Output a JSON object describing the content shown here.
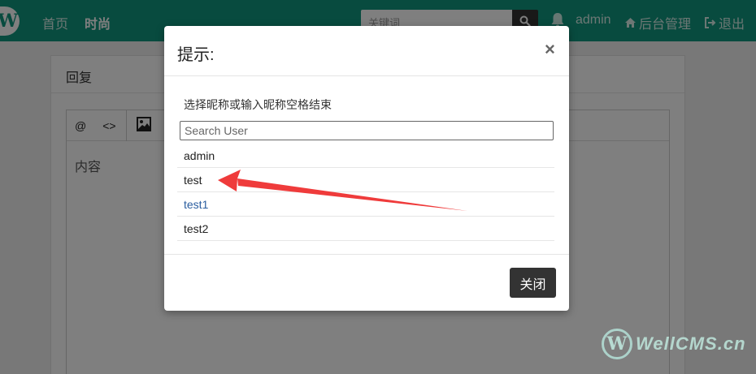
{
  "navbar": {
    "logo_letter": "W",
    "home": "首页",
    "fashion": "时尚",
    "search_placeholder": "关键词",
    "user": "admin",
    "backend": "后台管理",
    "logout": "退出",
    "bg_color": "#10967e"
  },
  "panel": {
    "title": "回复",
    "toolbar": [
      "@",
      "<>"
    ],
    "placeholder": "内容"
  },
  "modal": {
    "title": "提示:",
    "close_symbol": "×",
    "hint": "选择昵称或输入昵称空格结束",
    "search_placeholder": "Search User",
    "users": [
      "admin",
      "test",
      "test1",
      "test2"
    ],
    "close_label": "关闭"
  },
  "watermark": {
    "letter": "W",
    "text": "WellCMS.cn"
  },
  "annotation": {
    "arrow_color": "#ef3b3b",
    "points_to": "test"
  }
}
